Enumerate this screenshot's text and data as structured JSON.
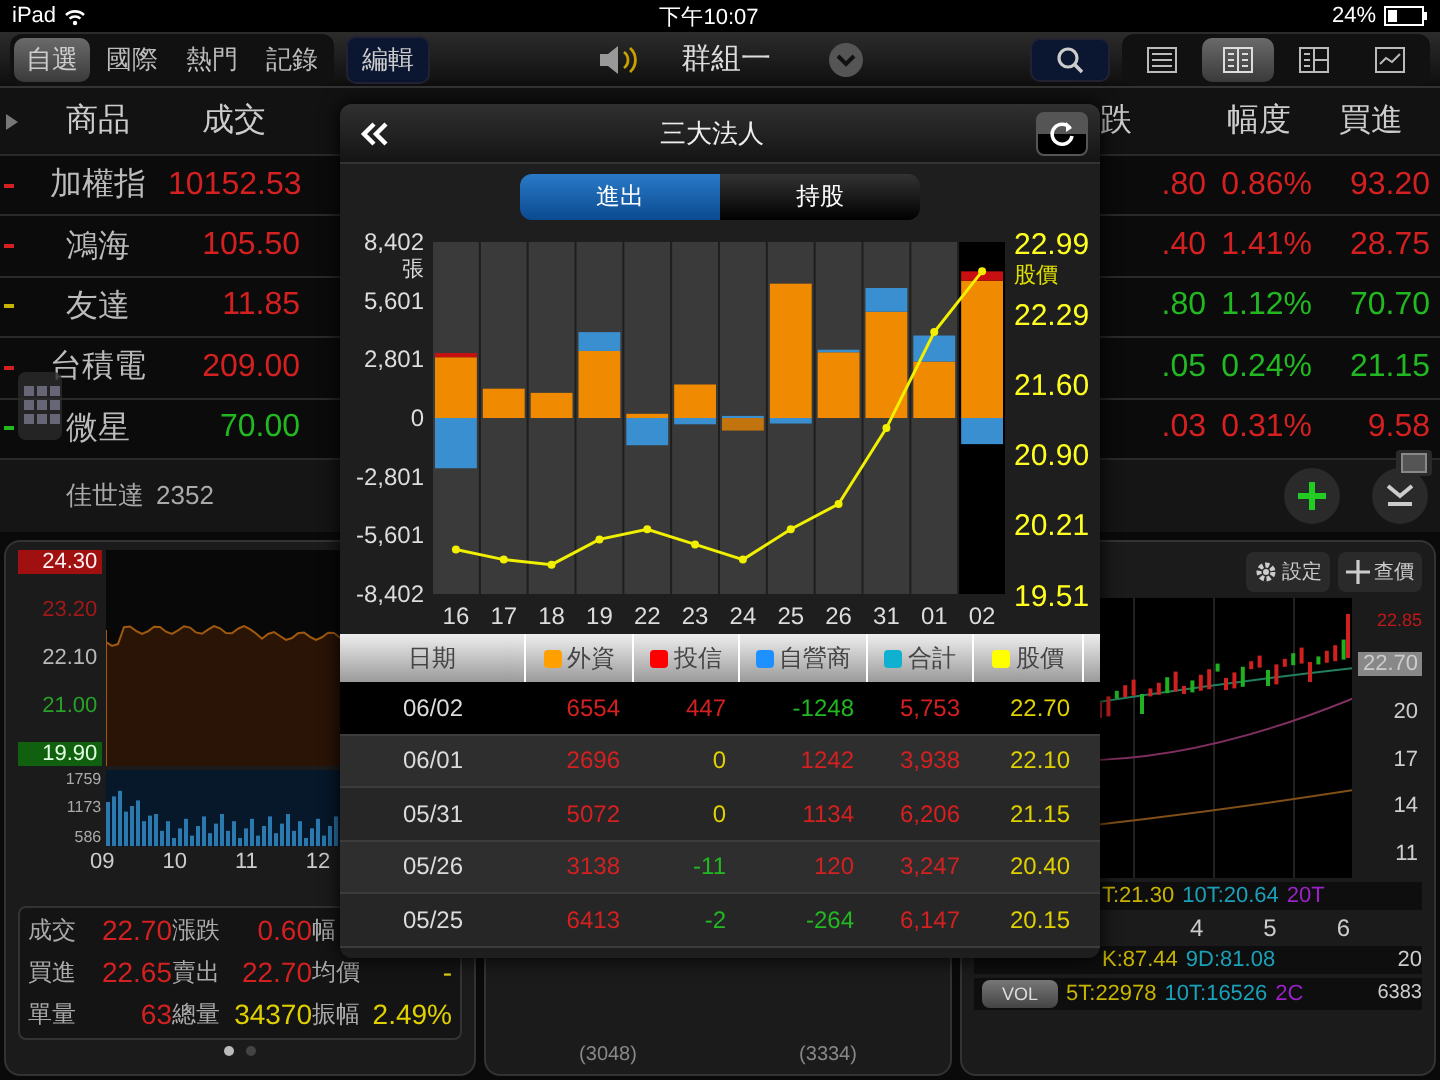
{
  "status_bar": {
    "device": "iPad",
    "time": "下午10:07",
    "battery": "24%"
  },
  "toolbar": {
    "tabs": [
      {
        "label": "自選",
        "selected": true
      },
      {
        "label": "國際",
        "selected": false
      },
      {
        "label": "熱門",
        "selected": false
      },
      {
        "label": "記錄",
        "selected": false
      }
    ],
    "edit_button": "編輯",
    "group": "群組一",
    "views": [
      {
        "kind": "list",
        "selected": false
      },
      {
        "kind": "columns",
        "selected": true
      },
      {
        "kind": "split",
        "selected": false
      },
      {
        "kind": "chart",
        "selected": false
      }
    ]
  },
  "quote_table": {
    "left_columns": [
      "商品",
      "成交"
    ],
    "right_columns": [
      "跌",
      "幅度",
      "買進"
    ],
    "rows": [
      {
        "name": "加權指",
        "color": "#d42020",
        "price": {
          "text": "10152.53",
          "color": "#d42020"
        },
        "right_cells": [
          {
            "text": ".80",
            "color": "#d42020"
          },
          {
            "text": "0.86%",
            "color": "#d42020"
          },
          {
            "text": "93.20",
            "color": "#d42020"
          }
        ]
      },
      {
        "name": "鴻海",
        "color": "#d42020",
        "price": {
          "text": "105.50",
          "color": "#d42020"
        },
        "right_cells": [
          {
            "text": ".40",
            "color": "#d42020"
          },
          {
            "text": "1.41%",
            "color": "#d42020"
          },
          {
            "text": "28.75",
            "color": "#d42020"
          }
        ]
      },
      {
        "name": "友達",
        "color": "#c8b400",
        "price": {
          "text": "11.85",
          "color": "#d42020"
        },
        "right_cells": [
          {
            "text": ".80",
            "color": "#22b822"
          },
          {
            "text": "1.12%",
            "color": "#22b822"
          },
          {
            "text": "70.70",
            "color": "#22b822"
          }
        ]
      },
      {
        "name": "台積電",
        "color": "#d42020",
        "price": {
          "text": "209.00",
          "color": "#d42020"
        },
        "right_cells": [
          {
            "text": ".05",
            "color": "#22b822"
          },
          {
            "text": "0.24%",
            "color": "#22b822"
          },
          {
            "text": "21.15",
            "color": "#22b822"
          }
        ]
      },
      {
        "name": "微星",
        "color": "#22b822",
        "price": {
          "text": "70.00",
          "color": "#22b822"
        },
        "right_cells": [
          {
            "text": ".03",
            "color": "#d42020"
          },
          {
            "text": "0.31%",
            "color": "#d42020"
          },
          {
            "text": "9.58",
            "color": "#d42020"
          }
        ]
      }
    ]
  },
  "current_stock": {
    "name": "佳世達",
    "code": "2352"
  },
  "intraday": {
    "price_labels": [
      {
        "text": "24.30",
        "kind": "limit_up"
      },
      {
        "text": "23.20",
        "kind": "up"
      },
      {
        "text": "22.10",
        "kind": "flat"
      },
      {
        "text": "21.00",
        "kind": "down"
      },
      {
        "text": "19.90",
        "kind": "limit_down"
      }
    ],
    "volume_labels": [
      "1759",
      "1173",
      "586"
    ],
    "time_labels": [
      "09",
      "10",
      "11",
      "12"
    ],
    "stats": [
      [
        {
          "label": "成交",
          "value": "22.70",
          "color": "#d42020"
        },
        {
          "label": "漲跌",
          "value": "0.60",
          "color": "#d42020"
        },
        {
          "label": "幅"
        }
      ],
      [
        {
          "label": "買進",
          "value": "22.65",
          "color": "#d42020"
        },
        {
          "label": "賣出",
          "value": "22.70",
          "color": "#d42020"
        },
        {
          "label": "均價",
          "value": "-",
          "color": "#e0d000"
        }
      ],
      [
        {
          "label": "單量",
          "value": "63",
          "color": "#d42020"
        },
        {
          "label": "總量",
          "value": "34370",
          "color": "#e0d000"
        },
        {
          "label": "振幅",
          "value": "2.49%",
          "color": "#e0d000"
        }
      ]
    ],
    "pages": [
      {
        "selected": true
      },
      {
        "selected": false
      }
    ]
  },
  "middle_panel": {
    "values": [
      "(3048)",
      "(3334)"
    ]
  },
  "kline": {
    "settings_button": "設定",
    "quote_button": "查價",
    "high": "22.85",
    "last": "22.70",
    "price_axis": [
      "20",
      "17",
      "14",
      "11"
    ],
    "ma_legend": [
      {
        "text": "T:21.30",
        "color": "#c8b400"
      },
      {
        "text": "10T:20.64",
        "color": "#1aa0b8"
      },
      {
        "text": "20T",
        "color": "#9a22c8"
      }
    ],
    "x_axis": [
      "4",
      "5",
      "6"
    ],
    "kd_legend": [
      {
        "text": "K:87.44",
        "color": "#c8b400"
      },
      {
        "text": "9D:81.08",
        "color": "#1aa0b8"
      }
    ],
    "kd_axis": "20",
    "vol_button": "VOL",
    "vol_legend": [
      {
        "text": "5T:22978",
        "color": "#c8b400"
      },
      {
        "text": "10T:16526",
        "color": "#1aa0b8"
      },
      {
        "text": "2C",
        "color": "#9a22c8"
      }
    ],
    "vol_axis": "6383"
  },
  "popup": {
    "title": "三大法人",
    "tabs": [
      {
        "label": "進出",
        "selected": true
      },
      {
        "label": "持股",
        "selected": false
      }
    ],
    "highlighted_day": "02",
    "flows": {
      "chart_data": {
        "type": "bar",
        "stacked": true,
        "ylabel": "張",
        "categories": [
          "16",
          "17",
          "18",
          "19",
          "22",
          "23",
          "24",
          "25",
          "26",
          "31",
          "01",
          "02"
        ],
        "series": [
          {
            "color": "#f08a00",
            "values": [
              2900,
              1400,
              1200,
              3200,
              200,
              1600,
              -600,
              6413,
              3138,
              5072,
              2696,
              6554
            ]
          },
          {
            "color": "#c81010",
            "values": [
              200,
              0,
              0,
              0,
              0,
              0,
              0,
              null,
              null,
              0,
              0,
              447
            ]
          },
          {
            "color": "#3a8fd0",
            "values": [
              -2400,
              0,
              0,
              900,
              -1300,
              -300,
              100,
              -264,
              120,
              1134,
              1242,
              -1248
            ]
          }
        ],
        "ylim": [
          -8402,
          8402
        ],
        "yticks": [
          {
            "value": 8402,
            "label": "8,402"
          },
          {
            "value": 5601,
            "label": "5,601"
          },
          {
            "value": 2801,
            "label": "2,801"
          },
          {
            "value": 0,
            "label": "0"
          },
          {
            "value": -2801,
            "label": "-2,801"
          },
          {
            "value": -5601,
            "label": "-5,601"
          },
          {
            "value": -8402,
            "label": "-8,402"
          }
        ]
      }
    },
    "price": {
      "chart_data": {
        "type": "line",
        "ylabel": "股價",
        "series": [
          {
            "color": "#f0f000",
            "marker": "o",
            "values": [
              19.95,
              19.85,
              19.8,
              20.05,
              20.15,
              20.0,
              19.85,
              20.15,
              20.4,
              21.15,
              22.1,
              22.7
            ]
          }
        ],
        "ylim": [
          19.51,
          22.99
        ],
        "yticks": [
          {
            "value": 22.99,
            "label": "22.99"
          },
          {
            "value": 22.29,
            "label": "22.29"
          },
          {
            "value": 21.6,
            "label": "21.60"
          },
          {
            "value": 20.9,
            "label": "20.90"
          },
          {
            "value": 20.21,
            "label": "20.21"
          },
          {
            "value": 19.51,
            "label": "19.51"
          }
        ]
      }
    },
    "table": {
      "columns": [
        {
          "label": "日期"
        },
        {
          "label": "外資",
          "color": "#ffa000"
        },
        {
          "label": "投信",
          "color": "#ff0000"
        },
        {
          "label": "自營商",
          "color": "#1e90ff"
        },
        {
          "label": "合計",
          "color": "#10b0d0"
        },
        {
          "label": "股價",
          "color": "#ffff00"
        }
      ],
      "rows": [
        {
          "selected": true,
          "cells": [
            {
              "text": "06/02"
            },
            {
              "text": "6554",
              "color": "#d42020"
            },
            {
              "text": "447",
              "color": "#d42020"
            },
            {
              "text": "-1248",
              "color": "#22b822"
            },
            {
              "text": "5,753",
              "color": "#d42020"
            },
            {
              "text": "22.70",
              "color": "#e0d000"
            }
          ]
        },
        {
          "selected": false,
          "cells": [
            {
              "text": "06/01"
            },
            {
              "text": "2696",
              "color": "#d42020"
            },
            {
              "text": "0",
              "color": "#e0d000"
            },
            {
              "text": "1242",
              "color": "#d42020"
            },
            {
              "text": "3,938",
              "color": "#d42020"
            },
            {
              "text": "22.10",
              "color": "#e0d000"
            }
          ]
        },
        {
          "selected": false,
          "cells": [
            {
              "text": "05/31"
            },
            {
              "text": "5072",
              "color": "#d42020"
            },
            {
              "text": "0",
              "color": "#e0d000"
            },
            {
              "text": "1134",
              "color": "#d42020"
            },
            {
              "text": "6,206",
              "color": "#d42020"
            },
            {
              "text": "21.15",
              "color": "#e0d000"
            }
          ]
        },
        {
          "selected": false,
          "cells": [
            {
              "text": "05/26"
            },
            {
              "text": "3138",
              "color": "#d42020"
            },
            {
              "text": "-11",
              "color": "#22b822"
            },
            {
              "text": "120",
              "color": "#d42020"
            },
            {
              "text": "3,247",
              "color": "#d42020"
            },
            {
              "text": "20.40",
              "color": "#e0d000"
            }
          ]
        },
        {
          "selected": false,
          "cells": [
            {
              "text": "05/25"
            },
            {
              "text": "6413",
              "color": "#d42020"
            },
            {
              "text": "-2",
              "color": "#22b822"
            },
            {
              "text": "-264",
              "color": "#22b822"
            },
            {
              "text": "6,147",
              "color": "#d42020"
            },
            {
              "text": "20.15",
              "color": "#e0d000"
            }
          ]
        }
      ]
    }
  }
}
